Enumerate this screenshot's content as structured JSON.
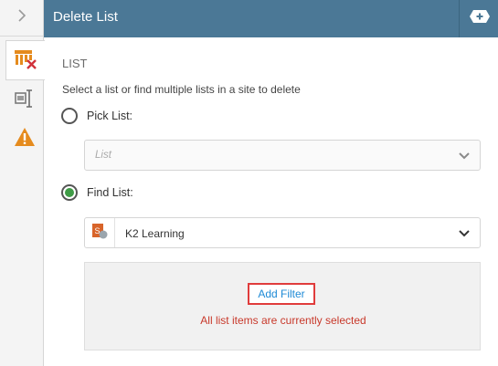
{
  "header": {
    "title": "Delete List"
  },
  "main": {
    "section_title": "LIST",
    "description": "Select a list or find multiple lists in a site to delete",
    "pick_list": {
      "label": "Pick List:",
      "selected": false,
      "placeholder": "List"
    },
    "find_list": {
      "label": "Find List:",
      "selected": true,
      "value": "K2 Learning"
    },
    "filter": {
      "add_filter_label": "Add Filter",
      "status_text": "All list items are currently selected"
    }
  },
  "colors": {
    "header_bg": "#4b7896",
    "radio_selected": "#3f9b46",
    "link": "#1e8ad6",
    "status_text": "#c8392b",
    "highlight_border": "#e03c3c"
  },
  "icons": [
    "chevron-right-icon",
    "delete-list-icon",
    "properties-icon",
    "warning-icon",
    "add-step-icon",
    "chevron-down-icon",
    "sharepoint-site-icon"
  ]
}
